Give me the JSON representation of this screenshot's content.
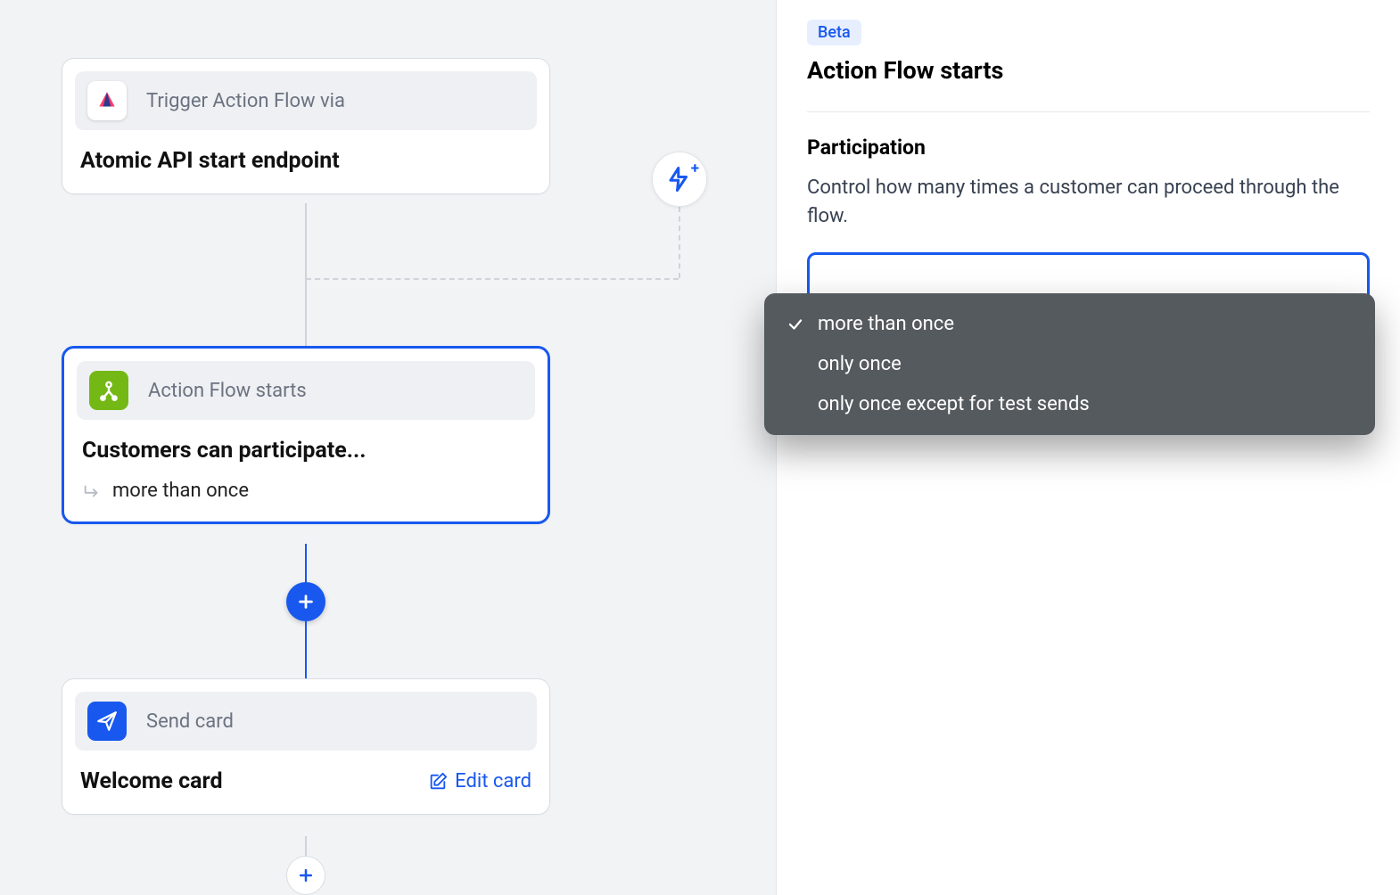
{
  "canvas": {
    "trigger_node": {
      "header_label": "Trigger Action Flow via",
      "title": "Atomic API start endpoint"
    },
    "start_node": {
      "header_label": "Action Flow starts",
      "title": "Customers can participate...",
      "subtitle": "more than once"
    },
    "send_node": {
      "header_label": "Send card",
      "title": "Welcome card",
      "edit_label": "Edit card"
    }
  },
  "sidebar": {
    "badge": "Beta",
    "title": "Action Flow starts",
    "participation": {
      "heading": "Participation",
      "description": "Control how many times a customer can proceed through the flow.",
      "selected": "more than once",
      "options": [
        "more than once",
        "only once",
        "only once except for test sends"
      ]
    }
  }
}
